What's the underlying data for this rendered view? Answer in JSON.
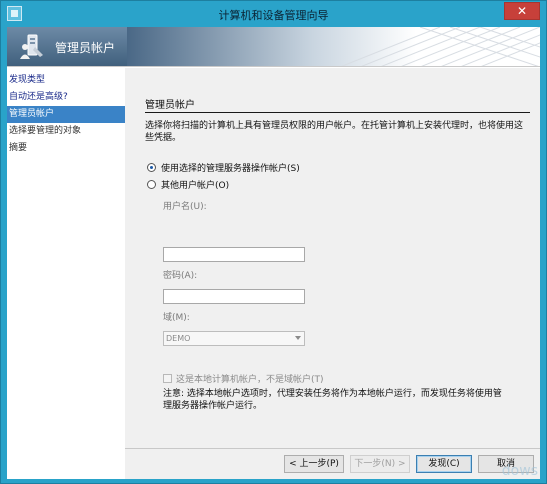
{
  "window": {
    "title": "计算机和设备管理向导",
    "close_glyph": "✕"
  },
  "banner": {
    "title": "管理员帐户"
  },
  "nav": {
    "items": [
      {
        "label": "发现类型"
      },
      {
        "label": "自动还是高级?"
      },
      {
        "label": "管理员帐户"
      },
      {
        "label": "选择要管理的对象"
      },
      {
        "label": "摘要"
      }
    ]
  },
  "content": {
    "section_title": "管理员帐户",
    "description": "选择你将扫描的计算机上具有管理员权限的用户帐户。在托管计算机上安装代理时，也将使用这些凭据。",
    "radio_service": "使用选择的管理服务器操作帐户(S)",
    "radio_other": "其他用户帐户(O)",
    "username_label": "用户名(U):",
    "username_value": "",
    "password_label": "密码(A):",
    "password_value": "",
    "domain_label": "域(M):",
    "domain_value": "DEMO",
    "local_account_label": "这是本地计算机帐户，不是域帐户(T)",
    "note": "注意: 选择本地帐户选项时，代理安装任务将作为本地帐户运行，而发现任务将使用管理服务器操作帐户运行。"
  },
  "footer": {
    "back_label": "< 上一步(P)",
    "next_label": "下一步(N) >",
    "discover_label": "发现(C)",
    "cancel_label": "取消"
  },
  "watermark": {
    "text": "dows"
  },
  "colors": {
    "title_bar": "#2aa3ca",
    "nav_active": "#3a83c7",
    "close_button": "#c7403a"
  }
}
